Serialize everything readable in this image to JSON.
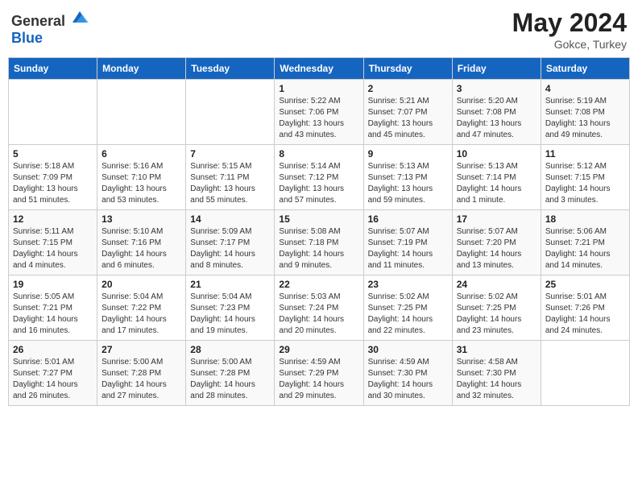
{
  "header": {
    "logo_general": "General",
    "logo_blue": "Blue",
    "title": "May 2024",
    "location": "Gokce, Turkey"
  },
  "weekdays": [
    "Sunday",
    "Monday",
    "Tuesday",
    "Wednesday",
    "Thursday",
    "Friday",
    "Saturday"
  ],
  "weeks": [
    [
      {
        "day": "",
        "sunrise": "",
        "sunset": "",
        "daylight": ""
      },
      {
        "day": "",
        "sunrise": "",
        "sunset": "",
        "daylight": ""
      },
      {
        "day": "",
        "sunrise": "",
        "sunset": "",
        "daylight": ""
      },
      {
        "day": "1",
        "sunrise": "Sunrise: 5:22 AM",
        "sunset": "Sunset: 7:06 PM",
        "daylight": "Daylight: 13 hours and 43 minutes."
      },
      {
        "day": "2",
        "sunrise": "Sunrise: 5:21 AM",
        "sunset": "Sunset: 7:07 PM",
        "daylight": "Daylight: 13 hours and 45 minutes."
      },
      {
        "day": "3",
        "sunrise": "Sunrise: 5:20 AM",
        "sunset": "Sunset: 7:08 PM",
        "daylight": "Daylight: 13 hours and 47 minutes."
      },
      {
        "day": "4",
        "sunrise": "Sunrise: 5:19 AM",
        "sunset": "Sunset: 7:08 PM",
        "daylight": "Daylight: 13 hours and 49 minutes."
      }
    ],
    [
      {
        "day": "5",
        "sunrise": "Sunrise: 5:18 AM",
        "sunset": "Sunset: 7:09 PM",
        "daylight": "Daylight: 13 hours and 51 minutes."
      },
      {
        "day": "6",
        "sunrise": "Sunrise: 5:16 AM",
        "sunset": "Sunset: 7:10 PM",
        "daylight": "Daylight: 13 hours and 53 minutes."
      },
      {
        "day": "7",
        "sunrise": "Sunrise: 5:15 AM",
        "sunset": "Sunset: 7:11 PM",
        "daylight": "Daylight: 13 hours and 55 minutes."
      },
      {
        "day": "8",
        "sunrise": "Sunrise: 5:14 AM",
        "sunset": "Sunset: 7:12 PM",
        "daylight": "Daylight: 13 hours and 57 minutes."
      },
      {
        "day": "9",
        "sunrise": "Sunrise: 5:13 AM",
        "sunset": "Sunset: 7:13 PM",
        "daylight": "Daylight: 13 hours and 59 minutes."
      },
      {
        "day": "10",
        "sunrise": "Sunrise: 5:13 AM",
        "sunset": "Sunset: 7:14 PM",
        "daylight": "Daylight: 14 hours and 1 minute."
      },
      {
        "day": "11",
        "sunrise": "Sunrise: 5:12 AM",
        "sunset": "Sunset: 7:15 PM",
        "daylight": "Daylight: 14 hours and 3 minutes."
      }
    ],
    [
      {
        "day": "12",
        "sunrise": "Sunrise: 5:11 AM",
        "sunset": "Sunset: 7:15 PM",
        "daylight": "Daylight: 14 hours and 4 minutes."
      },
      {
        "day": "13",
        "sunrise": "Sunrise: 5:10 AM",
        "sunset": "Sunset: 7:16 PM",
        "daylight": "Daylight: 14 hours and 6 minutes."
      },
      {
        "day": "14",
        "sunrise": "Sunrise: 5:09 AM",
        "sunset": "Sunset: 7:17 PM",
        "daylight": "Daylight: 14 hours and 8 minutes."
      },
      {
        "day": "15",
        "sunrise": "Sunrise: 5:08 AM",
        "sunset": "Sunset: 7:18 PM",
        "daylight": "Daylight: 14 hours and 9 minutes."
      },
      {
        "day": "16",
        "sunrise": "Sunrise: 5:07 AM",
        "sunset": "Sunset: 7:19 PM",
        "daylight": "Daylight: 14 hours and 11 minutes."
      },
      {
        "day": "17",
        "sunrise": "Sunrise: 5:07 AM",
        "sunset": "Sunset: 7:20 PM",
        "daylight": "Daylight: 14 hours and 13 minutes."
      },
      {
        "day": "18",
        "sunrise": "Sunrise: 5:06 AM",
        "sunset": "Sunset: 7:21 PM",
        "daylight": "Daylight: 14 hours and 14 minutes."
      }
    ],
    [
      {
        "day": "19",
        "sunrise": "Sunrise: 5:05 AM",
        "sunset": "Sunset: 7:21 PM",
        "daylight": "Daylight: 14 hours and 16 minutes."
      },
      {
        "day": "20",
        "sunrise": "Sunrise: 5:04 AM",
        "sunset": "Sunset: 7:22 PM",
        "daylight": "Daylight: 14 hours and 17 minutes."
      },
      {
        "day": "21",
        "sunrise": "Sunrise: 5:04 AM",
        "sunset": "Sunset: 7:23 PM",
        "daylight": "Daylight: 14 hours and 19 minutes."
      },
      {
        "day": "22",
        "sunrise": "Sunrise: 5:03 AM",
        "sunset": "Sunset: 7:24 PM",
        "daylight": "Daylight: 14 hours and 20 minutes."
      },
      {
        "day": "23",
        "sunrise": "Sunrise: 5:02 AM",
        "sunset": "Sunset: 7:25 PM",
        "daylight": "Daylight: 14 hours and 22 minutes."
      },
      {
        "day": "24",
        "sunrise": "Sunrise: 5:02 AM",
        "sunset": "Sunset: 7:25 PM",
        "daylight": "Daylight: 14 hours and 23 minutes."
      },
      {
        "day": "25",
        "sunrise": "Sunrise: 5:01 AM",
        "sunset": "Sunset: 7:26 PM",
        "daylight": "Daylight: 14 hours and 24 minutes."
      }
    ],
    [
      {
        "day": "26",
        "sunrise": "Sunrise: 5:01 AM",
        "sunset": "Sunset: 7:27 PM",
        "daylight": "Daylight: 14 hours and 26 minutes."
      },
      {
        "day": "27",
        "sunrise": "Sunrise: 5:00 AM",
        "sunset": "Sunset: 7:28 PM",
        "daylight": "Daylight: 14 hours and 27 minutes."
      },
      {
        "day": "28",
        "sunrise": "Sunrise: 5:00 AM",
        "sunset": "Sunset: 7:28 PM",
        "daylight": "Daylight: 14 hours and 28 minutes."
      },
      {
        "day": "29",
        "sunrise": "Sunrise: 4:59 AM",
        "sunset": "Sunset: 7:29 PM",
        "daylight": "Daylight: 14 hours and 29 minutes."
      },
      {
        "day": "30",
        "sunrise": "Sunrise: 4:59 AM",
        "sunset": "Sunset: 7:30 PM",
        "daylight": "Daylight: 14 hours and 30 minutes."
      },
      {
        "day": "31",
        "sunrise": "Sunrise: 4:58 AM",
        "sunset": "Sunset: 7:30 PM",
        "daylight": "Daylight: 14 hours and 32 minutes."
      },
      {
        "day": "",
        "sunrise": "",
        "sunset": "",
        "daylight": ""
      }
    ]
  ]
}
